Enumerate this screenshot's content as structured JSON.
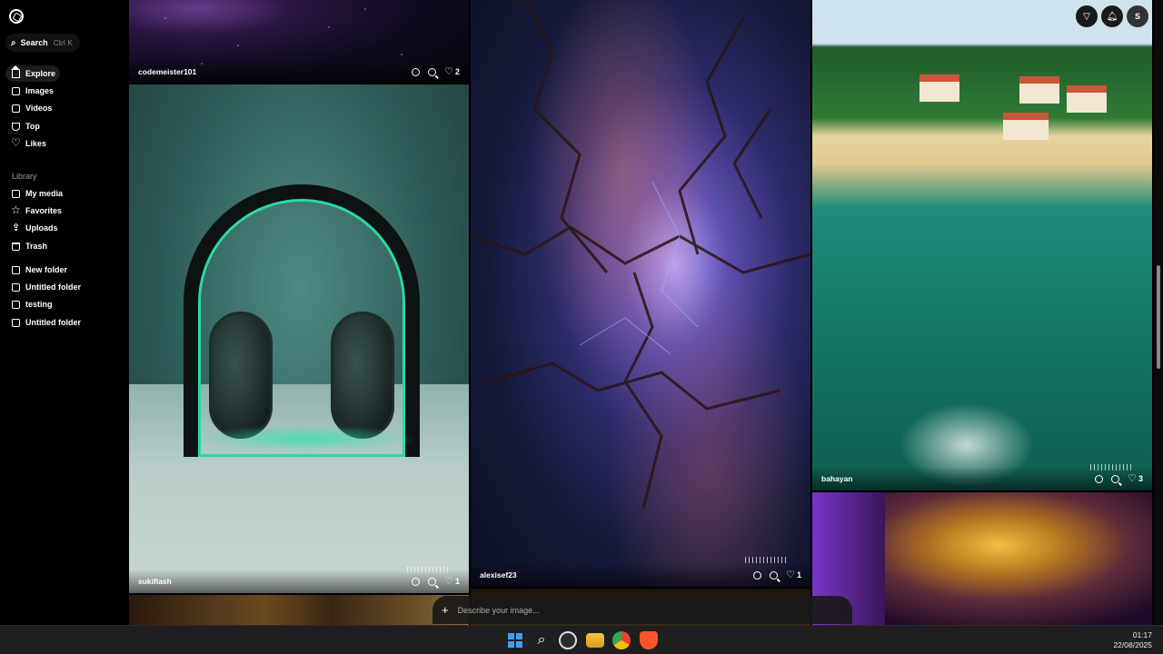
{
  "sidebar": {
    "search_label": "Search",
    "search_shortcut": "Ctrl K",
    "nav": [
      "Explore",
      "Images",
      "Videos",
      "Top",
      "Likes"
    ],
    "library_label": "Library",
    "library": [
      "My media",
      "Favorites",
      "Uploads",
      "Trash"
    ],
    "folders": [
      "New folder",
      "Untitled folder",
      "testing",
      "Untitled folder"
    ]
  },
  "tiles": {
    "galaxy": {
      "user": "codemeister101",
      "likes": "2"
    },
    "headphones": {
      "user": "sukiflash",
      "likes": "1"
    },
    "lightning": {
      "user": "alexisef23",
      "likes": "1"
    },
    "resort": {
      "user": "bahayan",
      "likes": "3"
    }
  },
  "topbar": {
    "avatar_letter": "S"
  },
  "prompt": {
    "placeholder": "Describe your image..."
  },
  "taskbar": {
    "time": "01:17",
    "date": "22/08/2025"
  },
  "icons": [
    "logo-icon",
    "search-icon",
    "home-icon",
    "image-icon",
    "video-icon",
    "trophy-icon",
    "heart-icon",
    "folder-icon",
    "star-icon",
    "upload-icon",
    "trash-icon",
    "remix-icon",
    "zoom-icon",
    "filter-icon",
    "bell-icon",
    "plus-icon"
  ]
}
